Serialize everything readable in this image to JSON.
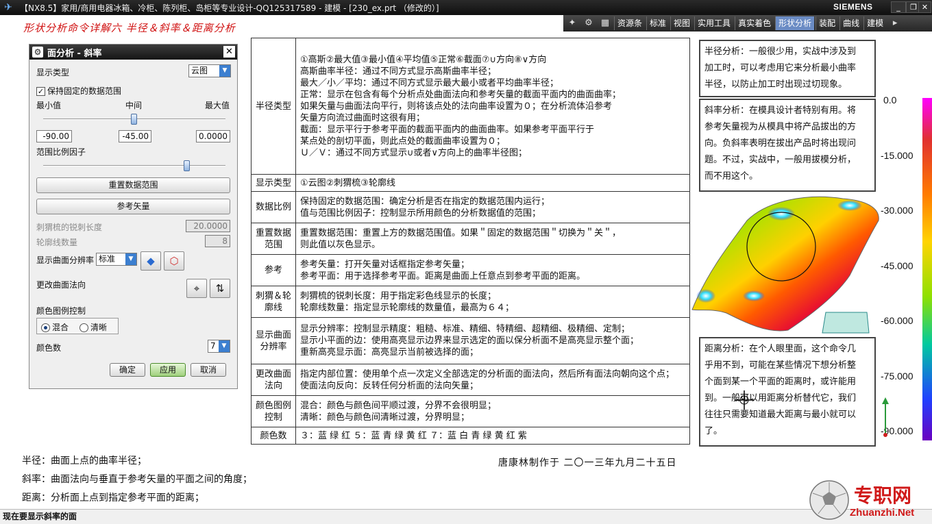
{
  "titlebar": {
    "title": "【NX8.5】家用/商用电器冰箱、冷柜、陈列柜、岛柜等专业设计-QQ125317589 - 建模 - [230_ex.prt （修改的）]",
    "brand": "SIEMENS",
    "buttons": [
      "_",
      "❐",
      "✕"
    ]
  },
  "toolbar": {
    "items": [
      "资源条",
      "标准",
      "视图",
      "实用工具",
      "真实着色",
      "形状分析",
      "装配",
      "曲线",
      "建模"
    ],
    "active": "形状分析"
  },
  "header": {
    "text": "形状分析命令详解六    半径＆斜率＆距离分析"
  },
  "dialog": {
    "title": "面分析 - 斜率",
    "display_type_label": "显示类型",
    "display_type_value": "云图",
    "keep_range_label": "保持固定的数据范围",
    "keep_range_checked": true,
    "min_label": "最小值",
    "mid_label": "中间",
    "max_label": "最大值",
    "min_value": "-90.00",
    "mid_value": "-45.00",
    "max_value": "0.0000",
    "range_scale_label": "范围比例因子",
    "reset_button": "重置数据范围",
    "ref_vector_button": "参考矢量",
    "stub_length_label": "刺猬梳的锐刺长度",
    "stub_length_value": "20.0000",
    "contour_count_label": "轮廓线数量",
    "contour_count_value": "8",
    "resolution_label": "显示曲面分辨率",
    "resolution_value": "标准",
    "change_normal_label": "更改曲面法向",
    "legend_control_label": "颜色图例控制",
    "radio_blend": "混合",
    "radio_sharp": "清晰",
    "color_count_label": "颜色数",
    "color_count_value": "7",
    "ok_button": "确定",
    "apply_button": "应用",
    "cancel_button": "取消"
  },
  "table": {
    "rows": [
      {
        "label": "半径类型",
        "lines": [
          "①高斯②最大值③最小值④平均值⑤正常⑥截面⑦∪方向⑧∨方向",
          "高斯曲率半径：通过不同方式显示高斯曲率半径；",
          "最大／小／平均：通过不同方式显示最大最小或者平均曲率半径；",
          "正常：显示在包含有每个分析点处曲面法向和参考矢量的截面平面内的曲面曲率；",
          "如果矢量与曲面法向平行，则将该点处的法向曲率设置为０；在分析流体沿参考",
          "矢量方向流过曲面时这很有用；",
          "截面：显示平行于参考平面的截面平面内的曲面曲率。如果参考平面平行于",
          "某点处的剖切平面，则此点处的截面曲率设置为０；",
          "Ｕ／Ｖ：通过不同方式显示∪或者∨方向上的曲率半径图；"
        ]
      },
      {
        "label": "显示类型",
        "lines": [
          "①云图②刺猬梳③轮廓线"
        ]
      },
      {
        "label": "数据比例",
        "lines": [
          "保持固定的数据范围：确定分析是否在指定的数据范围内运行；",
          "值与范围比例因子：控制显示所用颜色的分析数据值的范围；"
        ]
      },
      {
        "label": "重置数据范围",
        "lines": [
          "重置数据范围：重置上方的数据范围值。如果＂固定的数据范围＂切换为＂关＂，",
          "则此值以灰色显示。"
        ]
      },
      {
        "label": "参考",
        "lines": [
          "参考矢量：打开矢量对话框指定参考矢量；",
          "参考平面：用于选择参考平面。距离是曲面上任意点到参考平面的距离。"
        ]
      },
      {
        "label": "刺猬＆轮廓线",
        "lines": [
          "刺猬梳的锐刺长度：用于指定彩色线显示的长度；",
          "轮廓线数量：指定显示轮廓线的数量值，最高为６４；"
        ]
      },
      {
        "label": "显示曲面分辨率",
        "lines": [
          "显示分辨率：控制显示精度：粗糙、标准、精细、特精细、超精细、极精细、定制；",
          "显示小平面的边：使用高亮显示边界来显示选定的面以保分析面不是高亮显示整个面；",
          "重新高亮显示面：高亮显示当前被选择的面；"
        ]
      },
      {
        "label": "更改曲面法向",
        "lines": [
          "指定内部位置：使用单个点一次定义全部选定的分析面的面法向，然后所有面法向朝向这个点；",
          "使面法向反向：反转任何分析面的法向矢量；"
        ]
      },
      {
        "label": "颜色图例控制",
        "lines": [
          "混合：颜色与颜色间平顺过渡，分界不会很明显；",
          "清晰：颜色与颜色间清晰过渡，分界明显；"
        ]
      },
      {
        "label": "颜色数",
        "lines": [
          "３：蓝  绿  红      ５：蓝  青  绿  黄  红      ７：蓝  白  青  绿  黄  红  紫"
        ]
      }
    ]
  },
  "radius_box": {
    "lines": [
      "半径分析：一般很少用，实战中涉及到",
      "加工时，可以考虑用它来分析最小曲率",
      "半径，以防止加工时出现过切现象。"
    ]
  },
  "slope_box": {
    "lines": [
      "斜率分析：在模具设计者特别有用。将",
      "参考矢量视为从模具中将产品拔出的方",
      "向。负斜率表明在拔出产品时将出现问",
      "题。不过，实战中，一般用拔模分析，",
      "而不用这个。"
    ]
  },
  "distance_box": {
    "lines": [
      "距离分析：在个人眼里面，这个命令几",
      "乎用不到，可能在某些情况下想分析整",
      "个面到某一个平面的距离时，或许能用",
      "到。一般可以用距离分析替代它，我们",
      "往往只需要知道最大距离与最小就可以",
      "了。"
    ]
  },
  "scale": {
    "labels": [
      "0.0",
      "-15.000",
      "-30.000",
      "-45.000",
      "-60.000",
      "-75.000",
      "-90.000"
    ]
  },
  "notes": [
    "半径：曲面上点的曲率半径；",
    "斜率：曲面法向与垂直于参考矢量的平面之间的角度；",
    "距离：分析面上点到指定参考平面的距离；"
  ],
  "author": "唐康林制作于  二〇一三年九月二十五日",
  "status": "现在要显示斜率的面",
  "watermark": {
    "text": "专职网",
    "url_text": "Zhuanzhi.Net"
  },
  "colors": {
    "header_red": "#d01010",
    "toolbar_active": "#6a8bc4",
    "apply_green": "#9fd07c"
  }
}
